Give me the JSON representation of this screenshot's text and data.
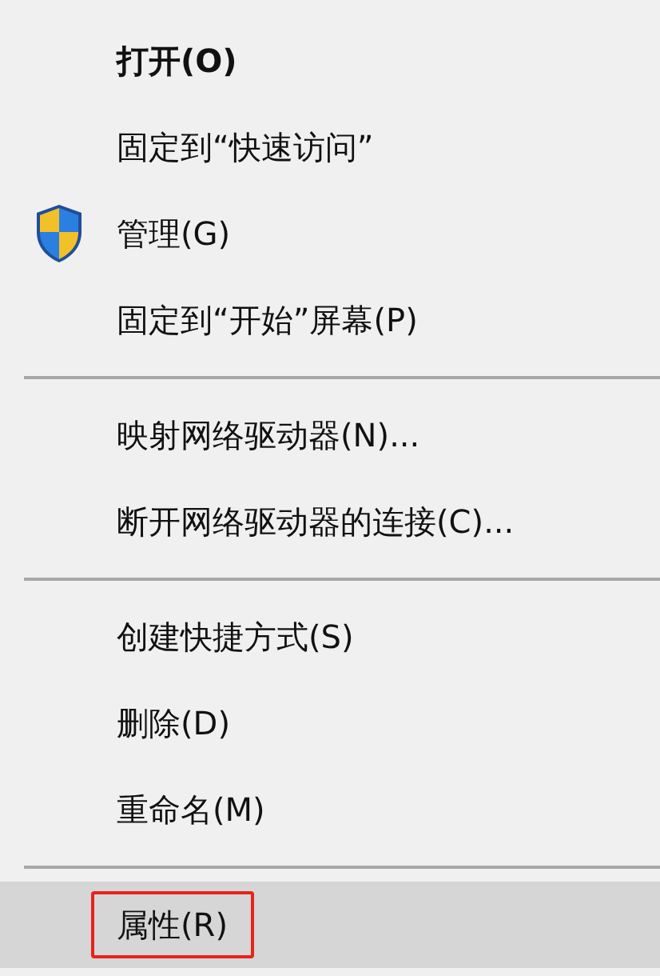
{
  "menu": {
    "items": [
      {
        "kind": "item",
        "label": "打开(O)",
        "default": true,
        "selected": false,
        "outlined": false
      },
      {
        "kind": "item",
        "label": "固定到“快速访问”",
        "default": false,
        "selected": false,
        "outlined": false
      },
      {
        "kind": "admin",
        "label": "管理(G)",
        "default": false,
        "selected": false,
        "outlined": false
      },
      {
        "kind": "item",
        "label": "固定到“开始”屏幕(P)",
        "default": false,
        "selected": false,
        "outlined": false
      },
      {
        "kind": "separator"
      },
      {
        "kind": "item",
        "label": "映射网络驱动器(N)...",
        "default": false,
        "selected": false,
        "outlined": false
      },
      {
        "kind": "item",
        "label": "断开网络驱动器的连接(C)...",
        "default": false,
        "selected": false,
        "outlined": false
      },
      {
        "kind": "separator"
      },
      {
        "kind": "item",
        "label": "创建快捷方式(S)",
        "default": false,
        "selected": false,
        "outlined": false
      },
      {
        "kind": "item",
        "label": "删除(D)",
        "default": false,
        "selected": false,
        "outlined": false
      },
      {
        "kind": "item",
        "label": "重命名(M)",
        "default": false,
        "selected": false,
        "outlined": false
      },
      {
        "kind": "separator"
      },
      {
        "kind": "item",
        "label": "属性(R)",
        "default": false,
        "selected": true,
        "outlined": true
      }
    ]
  }
}
